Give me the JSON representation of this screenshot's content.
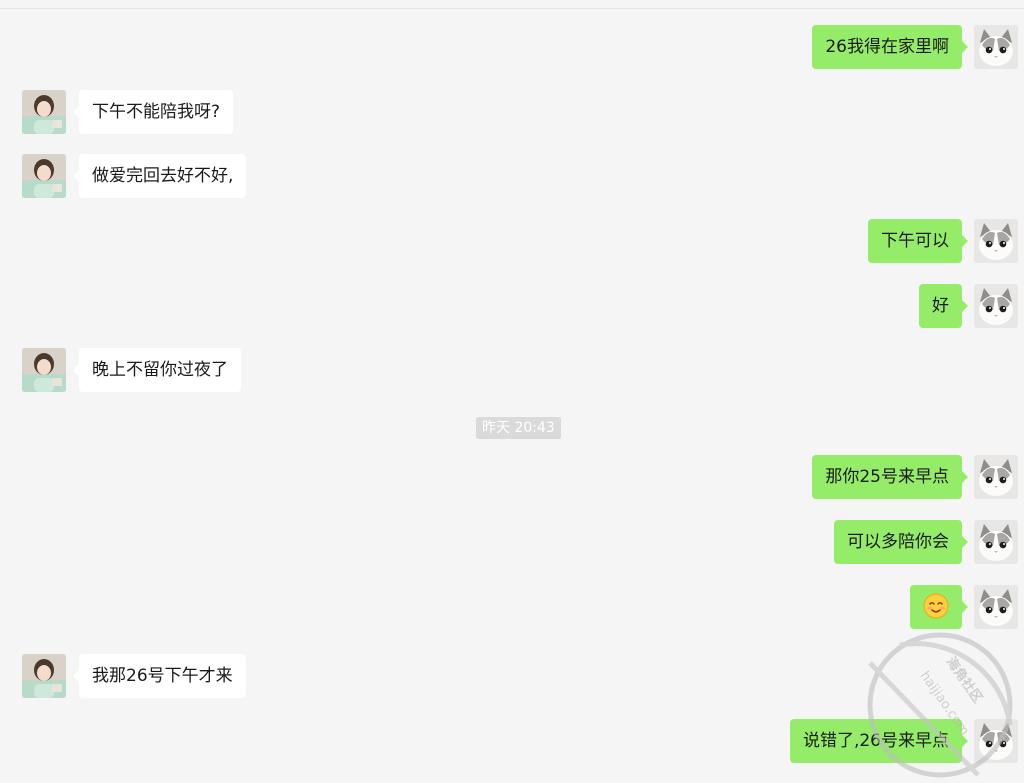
{
  "messages": [
    {
      "side": "right",
      "text": "26我得在家里啊"
    },
    {
      "side": "left",
      "text": "下午不能陪我呀?"
    },
    {
      "side": "left",
      "text": "做爱完回去好不好,"
    },
    {
      "side": "right",
      "text": "下午可以"
    },
    {
      "side": "right",
      "text": "好"
    },
    {
      "side": "left",
      "text": "晚上不留你过夜了"
    },
    {
      "side": "right",
      "text": "那你25号来早点"
    },
    {
      "side": "right",
      "text": "可以多陪你会"
    },
    {
      "side": "right",
      "emoji": "smiling-face-emoji"
    },
    {
      "side": "left",
      "text": "我那26号下午才来"
    },
    {
      "side": "right",
      "text": "说错了,26号来早点"
    }
  ],
  "timestamp": "昨天 20:43",
  "watermark": {
    "brand": "海角社区",
    "domain": "haijiao.com"
  },
  "colors": {
    "background": "#f5f5f5",
    "self_bubble": "#95ec69",
    "other_bubble": "#ffffff",
    "timestamp_bg": "#dadada"
  },
  "avatars": {
    "self": "cat-avatar",
    "other": "girl-avatar"
  }
}
